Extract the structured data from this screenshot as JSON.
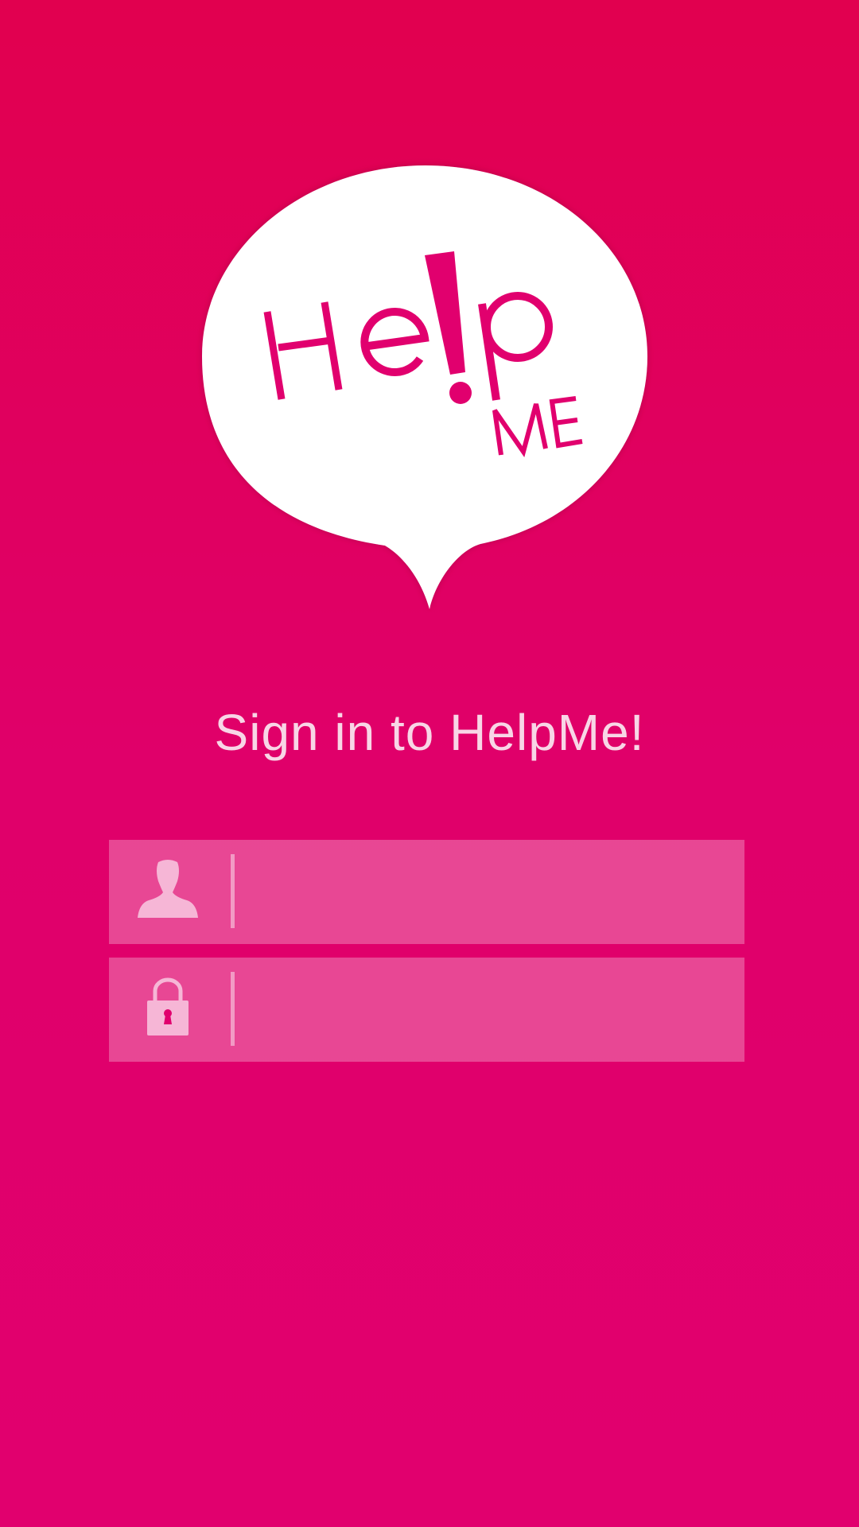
{
  "colors": {
    "background_top": "#e1004f",
    "background_bottom": "#e1006e",
    "brand_pink": "#e1006e",
    "bubble": "#ffffff",
    "headline_text": "#f8d6e6",
    "field_fill": "rgba(255,255,255,0.28)"
  },
  "logo": {
    "main_text": "Help",
    "sub_text": "ME"
  },
  "headline": "Sign in to HelpMe!",
  "username_field": {
    "icon": "user-silhouette-icon",
    "value": "",
    "placeholder": ""
  },
  "password_field": {
    "icon": "padlock-icon",
    "value": "",
    "placeholder": ""
  }
}
